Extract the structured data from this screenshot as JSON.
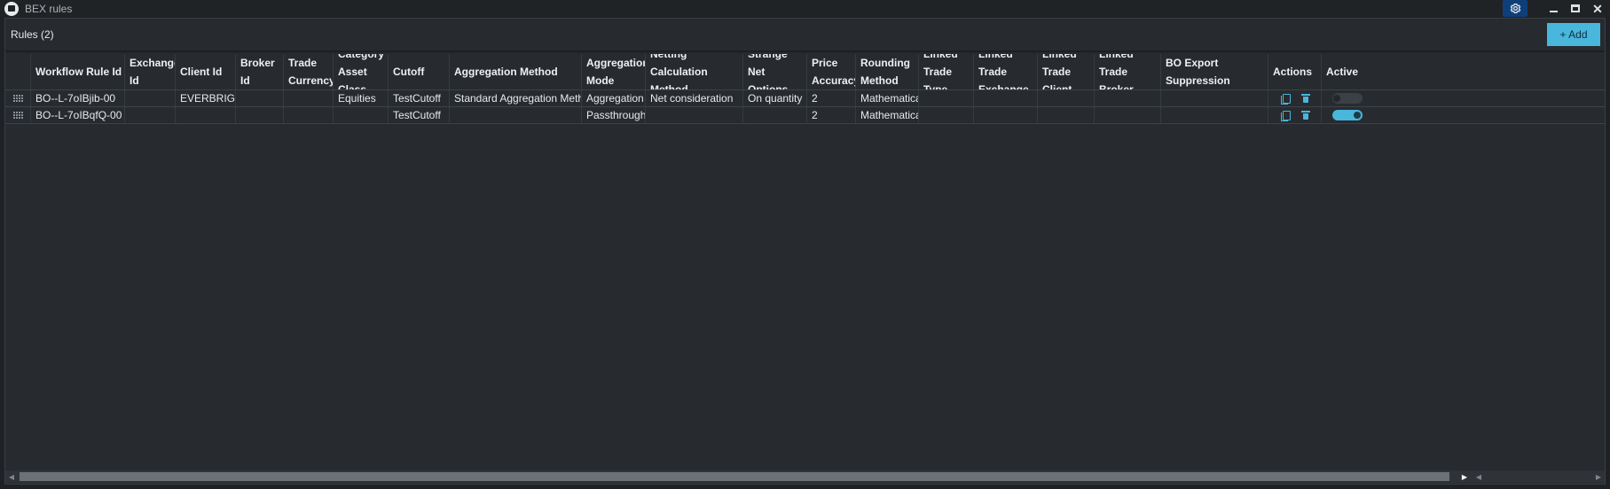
{
  "window": {
    "title": "BEX rules",
    "settings_icon": "gear-icon",
    "minimize_icon": "minimize-icon",
    "maximize_icon": "maximize-icon",
    "close_glyph": "✕"
  },
  "panel": {
    "title": "Rules (2)",
    "add_label": "+ Add"
  },
  "colors": {
    "accent": "#49b6dc",
    "background": "#272b2f",
    "titlebar": "#202326",
    "settings_button": "#0f3f78"
  },
  "table": {
    "columns": [
      {
        "key": "handle",
        "line1": "",
        "line2": ""
      },
      {
        "key": "workflow_rule_id",
        "line1": "Workflow Rule Id",
        "line2": ""
      },
      {
        "key": "exchange_id",
        "line1": "Exchange",
        "line2": "Id"
      },
      {
        "key": "client_id",
        "line1": "Client Id",
        "line2": ""
      },
      {
        "key": "broker_id",
        "line1": "Broker Id",
        "line2": ""
      },
      {
        "key": "trade_currency",
        "line1": "Trade",
        "line2": "Currency"
      },
      {
        "key": "category_asset_class",
        "line1": "Category",
        "line2": "Asset Class"
      },
      {
        "key": "cutoff",
        "line1": "Cutoff",
        "line2": ""
      },
      {
        "key": "aggregation_method",
        "line1": "Aggregation Method",
        "line2": ""
      },
      {
        "key": "aggregation_mode",
        "line1": "Aggregation",
        "line2": "Mode"
      },
      {
        "key": "netting_calculation_method",
        "line1": "Netting Calculation",
        "line2": "Method"
      },
      {
        "key": "strange_net_options",
        "line1": "Strange Net",
        "line2": "Options"
      },
      {
        "key": "price_accuracy",
        "line1": "Price",
        "line2": "Accuracy"
      },
      {
        "key": "rounding_method",
        "line1": "Rounding",
        "line2": "Method"
      },
      {
        "key": "linked_trade_type",
        "line1": "Linked",
        "line2": "Trade Type"
      },
      {
        "key": "linked_trade_exchange",
        "line1": "Linked Trade",
        "line2": "Exchange"
      },
      {
        "key": "linked_trade_client",
        "line1": "Linked",
        "line2": "Trade Client"
      },
      {
        "key": "linked_trade_broker",
        "line1": "Linked Trade",
        "line2": "Broker"
      },
      {
        "key": "bo_export_suppression",
        "line1": "BO Export Suppression",
        "line2": ""
      },
      {
        "key": "actions",
        "line1": "Actions",
        "line2": ""
      },
      {
        "key": "active",
        "line1": "Active",
        "line2": ""
      }
    ],
    "rows": [
      {
        "workflow_rule_id": "BO--L-7oIBjib-00",
        "exchange_id": "",
        "client_id": "EVERBRIGHT",
        "broker_id": "",
        "trade_currency": "",
        "category_asset_class": "Equities",
        "cutoff": "TestCutoff",
        "aggregation_method": "Standard Aggregation Method",
        "aggregation_mode": "Aggregation",
        "netting_calculation_method": "Net consideration",
        "strange_net_options": "On quantity",
        "price_accuracy": "2",
        "rounding_method": "Mathematical",
        "linked_trade_type": "",
        "linked_trade_exchange": "",
        "linked_trade_client": "",
        "linked_trade_broker": "",
        "bo_export_suppression": "",
        "active": false
      },
      {
        "workflow_rule_id": "BO--L-7oIBqfQ-00",
        "exchange_id": "",
        "client_id": "",
        "broker_id": "",
        "trade_currency": "",
        "category_asset_class": "",
        "cutoff": "TestCutoff",
        "aggregation_method": "",
        "aggregation_mode": "Passthrough",
        "netting_calculation_method": "",
        "strange_net_options": "",
        "price_accuracy": "2",
        "rounding_method": "Mathematical",
        "linked_trade_type": "",
        "linked_trade_exchange": "",
        "linked_trade_client": "",
        "linked_trade_broker": "",
        "bo_export_suppression": "",
        "active": true
      }
    ],
    "row_actions": [
      "copy-icon",
      "trash-icon"
    ]
  },
  "scrollbar": {
    "left_arrow": "◀",
    "right_arrow": "▶"
  }
}
